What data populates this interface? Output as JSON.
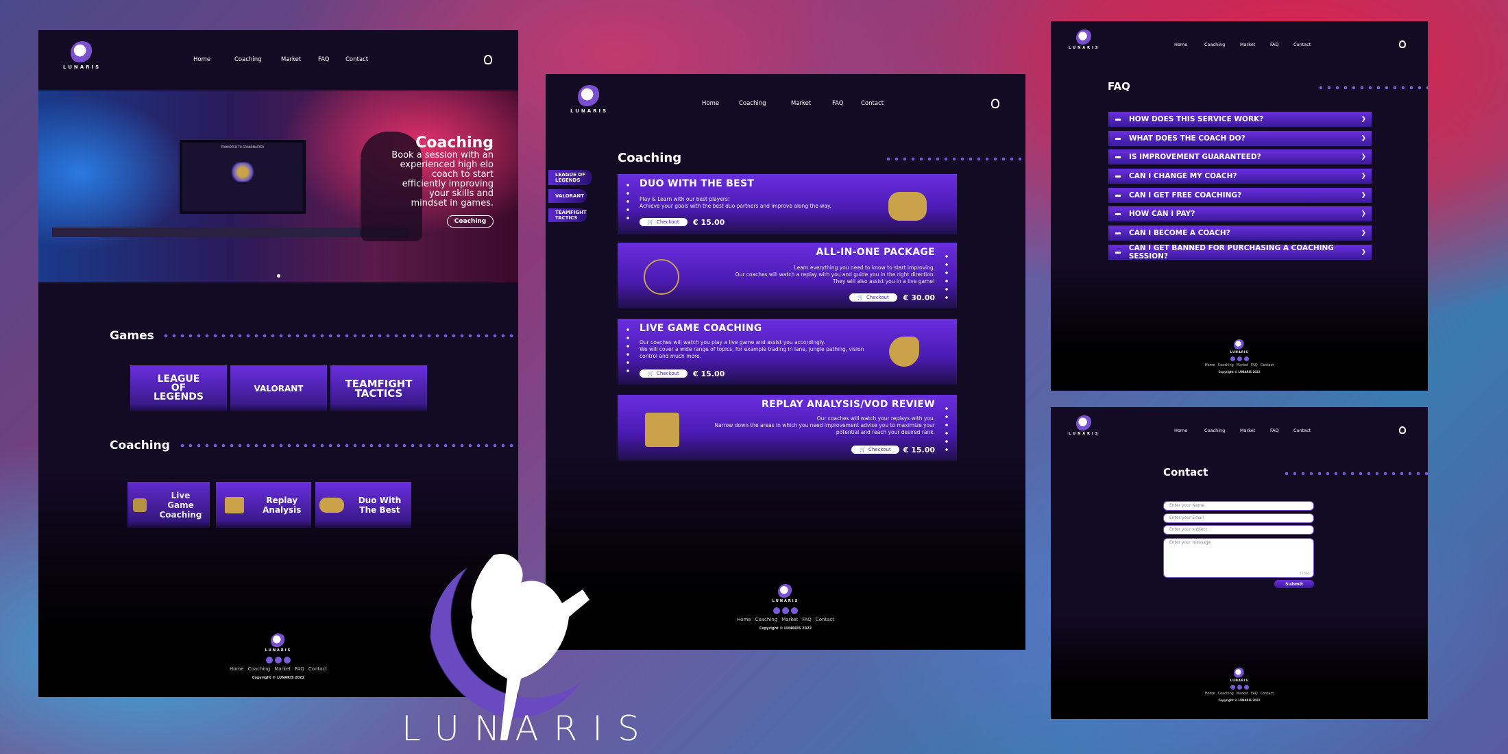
{
  "nav": {
    "home": "Home",
    "coaching": "Coaching",
    "market": "Market",
    "faq": "FAQ",
    "contact": "Contact"
  },
  "brand": {
    "logo_text": "LUNARIS",
    "big_wordmark": "LUNARIS"
  },
  "hero": {
    "title": "Coaching",
    "body": "Book a session with an experienced high elo coach to start efficiently improving your skills and mindset in games.",
    "button": "Coaching",
    "screen_text": "PROMOTED TO GRANDMASTER"
  },
  "games": {
    "title": "Games",
    "items": [
      "LEAGUE OF LEGENDS",
      "VALORANT",
      "TEAMFIGHT TACTICS"
    ]
  },
  "coaching_row": {
    "title": "Coaching",
    "items": [
      "Live Game Coaching",
      "Replay Analysis",
      "Duo With The Best"
    ]
  },
  "coaching_page": {
    "title": "Coaching",
    "side_tabs": [
      "LEAGUE OF LEGENDS",
      "VALORANT",
      "TEAMFIGHT TACTICS"
    ],
    "checkout": "Checkout",
    "cards": [
      {
        "title": "DUO WITH THE BEST",
        "desc": "Play & Learn with our best players!\nAchieve your goals with the best duo partners and improve along the way.",
        "price": "€ 15.00",
        "icon": "gamepad-icon"
      },
      {
        "title": "ALL-IN-ONE PACKAGE",
        "desc": "Learn everything you need to know to start improving.\nOur coaches will watch a replay with you and guide you in the right direction.\nThey will also assist you in a live game!",
        "price": "€ 30.00",
        "icon": "rings-icon"
      },
      {
        "title": "LIVE GAME COACHING",
        "desc": "Our coaches will watch you play a live game and assist you accordingly.\nWe will cover a wide range of topics, for example trading in lane, jungle pathing, vision control and much more.",
        "price": "€ 15.00",
        "icon": "whistle-icon"
      },
      {
        "title": "REPLAY ANALYSIS/VOD REVIEW",
        "desc": "Our coaches will watch your replays with you.\nNarrow down the areas in which you need improvement advise you to maximize your potential and reach your desired rank.",
        "price": "€ 15.00",
        "icon": "clapperboard-icon"
      }
    ]
  },
  "faq_page": {
    "title": "FAQ",
    "items": [
      "HOW DOES THIS SERVICE WORK?",
      "WHAT DOES THE COACH DO?",
      "IS IMPROVEMENT GUARANTEED?",
      "CAN I CHANGE MY COACH?",
      "CAN I GET FREE COACHING?",
      "HOW CAN I PAY?",
      "CAN I BECOME A COACH?",
      "CAN I GET BANNED FOR PURCHASING A COACHING SESSION?"
    ]
  },
  "contact_page": {
    "title": "Contact",
    "name_ph": "Enter your Name",
    "email_ph": "Enter your Email",
    "subject_ph": "Enter your subject",
    "message_ph": "Enter your message",
    "counter": "0 / 500",
    "submit": "Submit"
  },
  "footer": {
    "links": [
      "Home",
      "Coaching",
      "Market",
      "FAQ",
      "Contact"
    ],
    "copyright": "Copyright © LUNARIS 2022"
  },
  "colors": {
    "panel_bg": "#130a24",
    "accent": "#6a2ee0",
    "gold": "#c9a24a"
  }
}
